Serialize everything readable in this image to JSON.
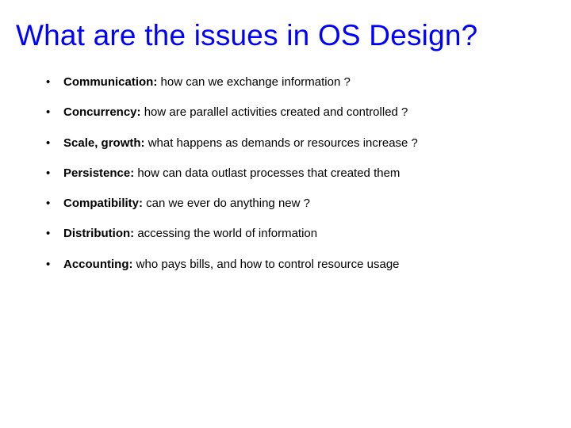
{
  "title": "What are the issues in OS Design?",
  "items": [
    {
      "term": "Communication:",
      "rest": " how can we exchange information ?"
    },
    {
      "term": "Concurrency:",
      "rest": " how are parallel activities created and controlled ?"
    },
    {
      "term": "Scale, growth:",
      "rest": " what happens as demands or resources increase ?"
    },
    {
      "term": "Persistence:",
      "rest": " how can data outlast processes that created them"
    },
    {
      "term": "Compatibility:",
      "rest": " can we ever do anything new ?"
    },
    {
      "term": "Distribution:",
      "rest": " accessing the world of information"
    },
    {
      "term": "Accounting:",
      "rest": " who pays bills, and how to control resource usage"
    }
  ]
}
